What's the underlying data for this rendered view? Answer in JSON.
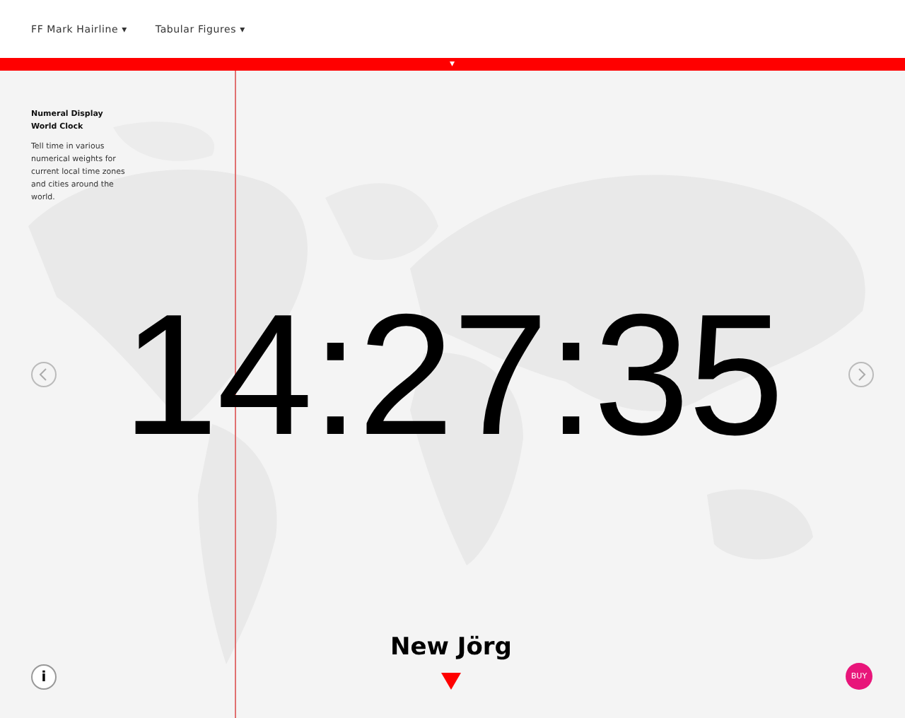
{
  "toolbar": {
    "dropdowns": [
      {
        "label": "FF Mark Hairline",
        "caret": "▾"
      },
      {
        "label": "Tabular Figures",
        "caret": "▾"
      }
    ]
  },
  "banner": {
    "toggle": "▾"
  },
  "intro": {
    "title": "Numeral Display World Clock",
    "text": "Tell time in various numerical weights for current local time zones and cities around the world."
  },
  "clock": {
    "time": "14:27:35"
  },
  "city": {
    "name": "New Jörg"
  },
  "buttons": {
    "info": "i",
    "buy": "BUY"
  }
}
